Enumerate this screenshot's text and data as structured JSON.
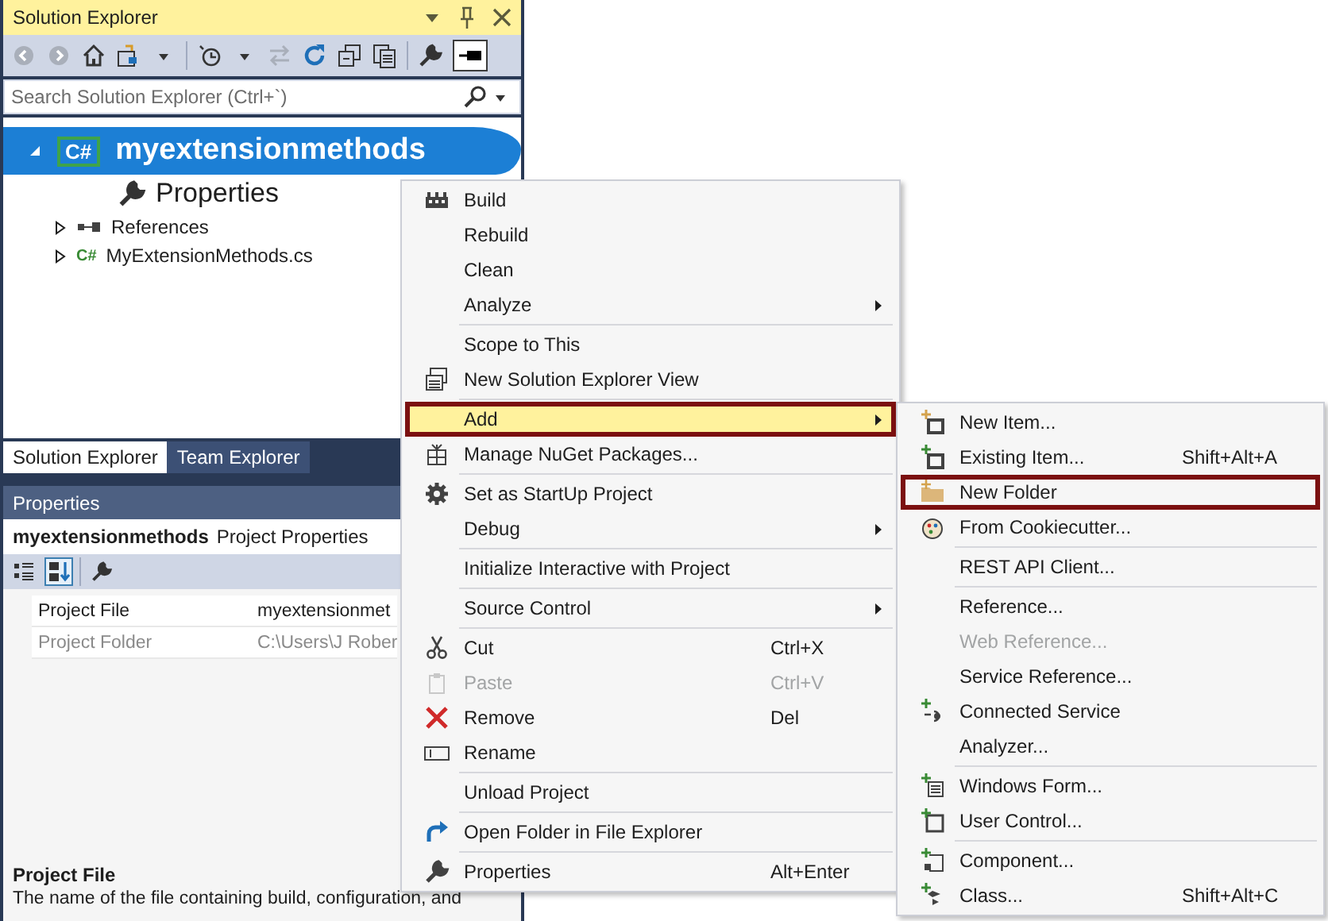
{
  "solution_explorer": {
    "title": "Solution Explorer",
    "search": {
      "placeholder": "Search Solution Explorer (Ctrl+`)"
    },
    "tree": [
      {
        "label": "myextensionmethods",
        "badge": "C#",
        "selected": true,
        "expanded": true,
        "children": [
          {
            "label": "Properties"
          },
          {
            "label": "References",
            "expanded": false
          },
          {
            "label": "MyExtensionMethods.cs",
            "badge": "C#",
            "expanded": false
          }
        ]
      }
    ],
    "tabs": [
      {
        "label": "Solution Explorer",
        "selected": true
      },
      {
        "label": "Team Explorer",
        "selected": false
      }
    ]
  },
  "properties": {
    "title": "Properties",
    "object_name": "myextensionmethods",
    "object_type": "Project Properties",
    "rows": [
      {
        "name": "Project File",
        "value": "myextensionmet",
        "disabled": false
      },
      {
        "name": "Project Folder",
        "value": "C:\\Users\\J Rober",
        "disabled": true
      }
    ],
    "description_title": "Project File",
    "description": "The name of the file containing build, configuration, and"
  },
  "context_menu": {
    "groups": [
      [
        {
          "label": "Build",
          "selected": false,
          "outlined": false,
          "disabled": false,
          "submenu": false
        },
        {
          "label": "Rebuild",
          "selected": false,
          "outlined": false,
          "disabled": false,
          "submenu": false
        },
        {
          "label": "Clean",
          "selected": false,
          "outlined": false,
          "disabled": false,
          "submenu": false
        },
        {
          "label": "Analyze",
          "selected": false,
          "outlined": false,
          "disabled": false,
          "submenu": true
        }
      ],
      [
        {
          "label": "Scope to This",
          "selected": false,
          "outlined": false,
          "disabled": false,
          "submenu": false
        },
        {
          "label": "New Solution Explorer View",
          "selected": false,
          "outlined": false,
          "disabled": false,
          "submenu": false
        }
      ],
      [
        {
          "label": "Add",
          "selected": true,
          "outlined": true,
          "disabled": false,
          "submenu": true
        },
        {
          "label": "Manage NuGet Packages...",
          "selected": false,
          "outlined": false,
          "disabled": false,
          "submenu": false
        }
      ],
      [
        {
          "label": "Set as StartUp Project",
          "selected": false,
          "outlined": false,
          "disabled": false,
          "submenu": false
        },
        {
          "label": "Debug",
          "selected": false,
          "outlined": false,
          "disabled": false,
          "submenu": true
        }
      ],
      [
        {
          "label": "Initialize Interactive with Project",
          "selected": false,
          "outlined": false,
          "disabled": false,
          "submenu": false
        }
      ],
      [
        {
          "label": "Source Control",
          "selected": false,
          "outlined": false,
          "disabled": false,
          "submenu": true
        }
      ],
      [
        {
          "label": "Cut",
          "shortcut": "Ctrl+X",
          "selected": false,
          "outlined": false,
          "disabled": false,
          "submenu": false
        },
        {
          "label": "Paste",
          "shortcut": "Ctrl+V",
          "selected": false,
          "outlined": false,
          "disabled": true,
          "submenu": false
        },
        {
          "label": "Remove",
          "shortcut": "Del",
          "selected": false,
          "outlined": false,
          "disabled": false,
          "submenu": false
        },
        {
          "label": "Rename",
          "selected": false,
          "outlined": false,
          "disabled": false,
          "submenu": false
        }
      ],
      [
        {
          "label": "Unload Project",
          "selected": false,
          "outlined": false,
          "disabled": false,
          "submenu": false
        }
      ],
      [
        {
          "label": "Open Folder in File Explorer",
          "selected": false,
          "outlined": false,
          "disabled": false,
          "submenu": false
        }
      ],
      [
        {
          "label": "Properties",
          "shortcut": "Alt+Enter",
          "selected": false,
          "outlined": false,
          "disabled": false,
          "submenu": false
        }
      ]
    ]
  },
  "add_submenu": {
    "groups": [
      [
        {
          "label": "New Item...",
          "selected": false,
          "outlined": false,
          "disabled": false,
          "submenu": false
        },
        {
          "label": "Existing Item...",
          "shortcut": "Shift+Alt+A",
          "selected": false,
          "outlined": false,
          "disabled": false,
          "submenu": false
        },
        {
          "label": "New Folder",
          "selected": false,
          "outlined": true,
          "disabled": false,
          "submenu": false
        },
        {
          "label": "From Cookiecutter...",
          "selected": false,
          "outlined": false,
          "disabled": false,
          "submenu": false
        }
      ],
      [
        {
          "label": "REST API Client...",
          "selected": false,
          "outlined": false,
          "disabled": false,
          "submenu": false
        }
      ],
      [
        {
          "label": "Reference...",
          "selected": false,
          "outlined": false,
          "disabled": false,
          "submenu": false
        },
        {
          "label": "Web Reference...",
          "selected": false,
          "outlined": false,
          "disabled": true,
          "submenu": false
        },
        {
          "label": "Service Reference...",
          "selected": false,
          "outlined": false,
          "disabled": false,
          "submenu": false
        },
        {
          "label": "Connected Service",
          "selected": false,
          "outlined": false,
          "disabled": false,
          "submenu": false
        },
        {
          "label": "Analyzer...",
          "selected": false,
          "outlined": false,
          "disabled": false,
          "submenu": false
        }
      ],
      [
        {
          "label": "Windows Form...",
          "selected": false,
          "outlined": false,
          "disabled": false,
          "submenu": false
        },
        {
          "label": "User Control...",
          "selected": false,
          "outlined": false,
          "disabled": false,
          "submenu": false
        }
      ],
      [
        {
          "label": "Component...",
          "selected": false,
          "outlined": false,
          "disabled": false,
          "submenu": false
        },
        {
          "label": "Class...",
          "shortcut": "Shift+Alt+C",
          "selected": false,
          "outlined": false,
          "disabled": false,
          "submenu": false
        }
      ]
    ]
  }
}
